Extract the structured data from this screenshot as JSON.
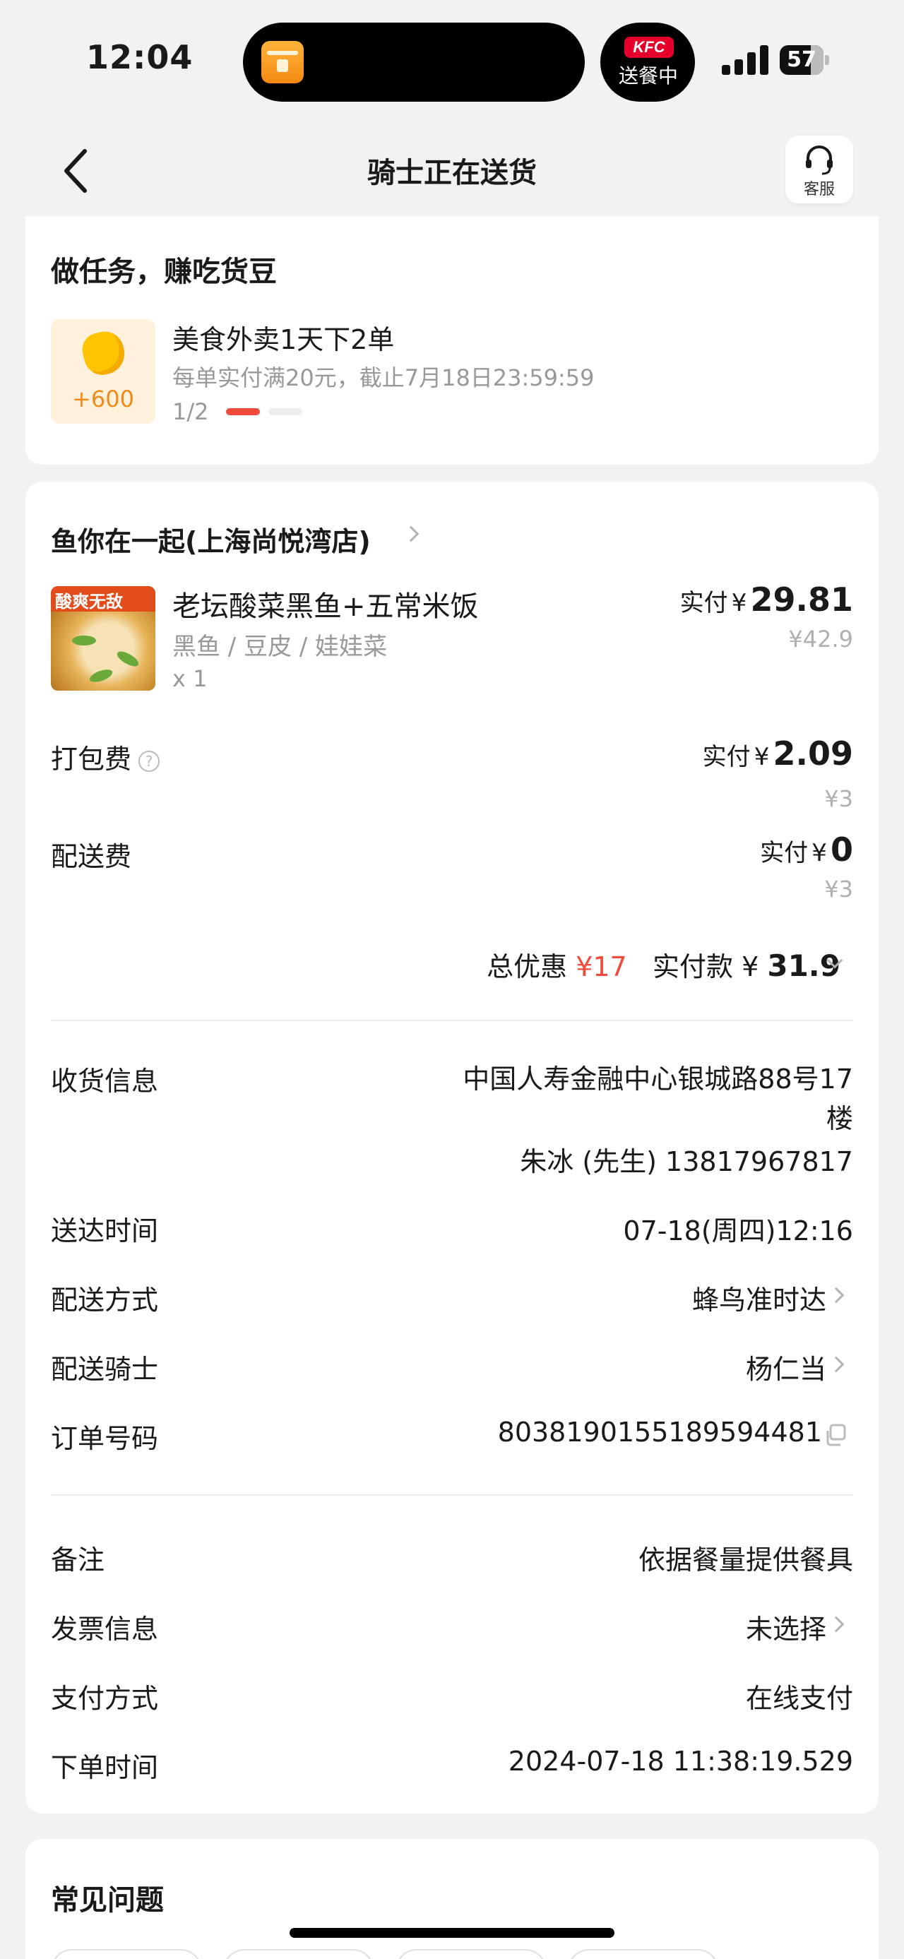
{
  "status_bar": {
    "time": "12:04",
    "live_activity_brand": "KFC",
    "live_activity_status": "送餐中",
    "battery": "57"
  },
  "header": {
    "title": "骑士正在送货",
    "service_label": "客服",
    "back_icon": "chevron-left-icon",
    "service_icon": "headset-icon"
  },
  "task": {
    "title": "做任务，赚吃货豆",
    "reward": "+600",
    "name": "美食外卖1天下2单",
    "description": "每单实付满20元，截止7月18日23:59:59",
    "progress_text": "1/2",
    "progress": 0.5
  },
  "order": {
    "store_name": "鱼你在一起(上海尚悦湾店)",
    "item": {
      "badge_text": "酸爽无敌",
      "name": "老坛酸菜黑鱼+五常米饭",
      "options": "黑鱼 / 豆皮 / 娃娃菜",
      "quantity": "x 1",
      "paid_label": "实付",
      "paid_currency": "¥",
      "paid_amount": "29.81",
      "original_price": "¥42.9"
    },
    "packing": {
      "label": "打包费",
      "paid_label": "实付",
      "paid_currency": "¥",
      "paid_amount": "2.09",
      "original_price": "¥3"
    },
    "delivery_fee": {
      "label": "配送费",
      "paid_label": "实付",
      "paid_currency": "¥",
      "paid_amount": "0",
      "original_price": "¥3"
    },
    "summary": {
      "discount_label": "总优惠",
      "discount_amount": "¥17",
      "paid_label": "实付款",
      "paid_currency": "¥",
      "paid_total": "31.9"
    }
  },
  "delivery": {
    "address_label": "收货信息",
    "address": "中国人寿金融中心银城路88号17楼",
    "contact": "朱冰 (先生) 13817967817",
    "arrival_label": "送达时间",
    "arrival_value": "07-18(周四)12:16",
    "method_label": "配送方式",
    "method_value": "蜂鸟准时达",
    "rider_label": "配送骑士",
    "rider_value": "杨仁当",
    "order_no_label": "订单号码",
    "order_no_value": "8038190155189594481"
  },
  "extra": {
    "remark_label": "备注",
    "remark_value": "依据餐量提供餐具",
    "invoice_label": "发票信息",
    "invoice_value": "未选择",
    "payment_label": "支付方式",
    "payment_value": "在线支付",
    "order_time_label": "下单时间",
    "order_time_value": "2024-07-18 11:38:19.529"
  },
  "faq": {
    "title": "常见问题"
  },
  "colors": {
    "accent_red": "#f04a3b",
    "reward_orange": "#f08a1a",
    "background": "#f2f2f2"
  }
}
